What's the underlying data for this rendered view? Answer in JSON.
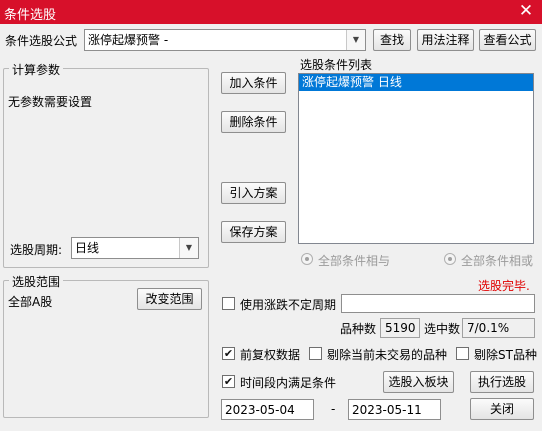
{
  "window": {
    "title": "条件选股",
    "close_glyph": "✕"
  },
  "formula": {
    "label": "条件选股公式",
    "value": "涨停起爆预警 -",
    "buttons": {
      "find": "查找",
      "usage": "用法注释",
      "view": "查看公式"
    }
  },
  "params": {
    "title": "计算参数",
    "text": "无参数需要设置"
  },
  "period": {
    "label": "选股周期:",
    "value": "日线"
  },
  "actions": {
    "add": "加入条件",
    "delete": "删除条件",
    "import": "引入方案",
    "save": "保存方案"
  },
  "conditions": {
    "title": "选股条件列表",
    "items": [
      {
        "label": "涨停起爆预警  日线",
        "selected": true
      }
    ],
    "radio_and": "全部条件相与",
    "radio_or": "全部条件相或"
  },
  "status": {
    "text": "选股完毕.",
    "color": "#e00000"
  },
  "range": {
    "title": "选股范围",
    "value": "全部A股",
    "change_button": "改变范围"
  },
  "variable_period": {
    "label": "使用涨跌不定周期",
    "checked": false,
    "value": ""
  },
  "stats": {
    "count_label": "品种数",
    "count_value": "5190",
    "selected_label": "选中数",
    "selected_value": "7/0.1%"
  },
  "options": {
    "forward_adjust": {
      "label": "前复权数据",
      "checked": true
    },
    "exclude_untraded": {
      "label": "剔除当前未交易的品种",
      "checked": false
    },
    "exclude_st": {
      "label": "剔除ST品种",
      "checked": false
    },
    "time_range": {
      "label": "时间段内满足条件",
      "checked": true
    }
  },
  "buttons": {
    "to_block": "选股入板块",
    "execute": "执行选股",
    "close": "关闭"
  },
  "dates": {
    "start": "2023-05-04",
    "separator": "-",
    "end": "2023-05-11"
  },
  "icons": {
    "checkmark": "✔",
    "combo_arrow": "▼"
  }
}
